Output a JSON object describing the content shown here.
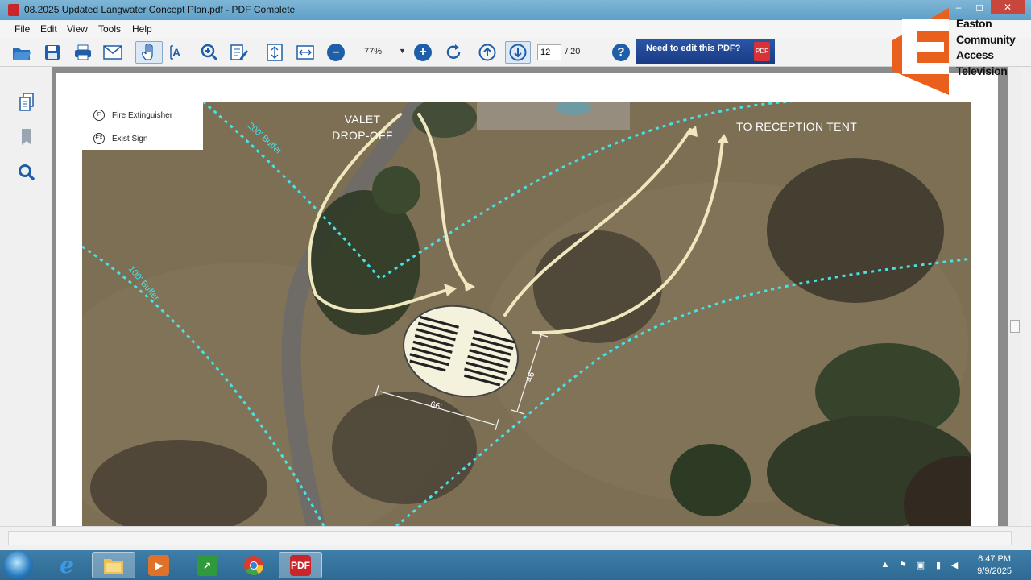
{
  "window": {
    "title": "08.2025 Updated Langwater Concept Plan.pdf - PDF Complete",
    "controls": [
      "–",
      "◻",
      "✕"
    ]
  },
  "menu": {
    "items": [
      "File",
      "Edit",
      "View",
      "Tools",
      "Help"
    ]
  },
  "toolbar": {
    "icons": [
      "open-folder-icon",
      "save-icon",
      "print-icon",
      "email-icon",
      "hand-tool-icon",
      "text-select-icon",
      "zoom-tool-icon",
      "edit-icon",
      "fit-page-icon",
      "fit-width-icon",
      "zoom-out-icon",
      "zoom-in-icon",
      "rotate-icon",
      "previous-page-icon",
      "next-page-icon",
      "help-icon"
    ],
    "zoom_value": "77%",
    "page_current": "12",
    "page_total": "/ 20",
    "promo_label": "Need to edit this PDF?",
    "promo_icon_text": "PDF"
  },
  "side_panel": {
    "icons": [
      "pages-icon",
      "bookmark-icon",
      "search-icon"
    ]
  },
  "map": {
    "legend": [
      {
        "symbol": "F",
        "label": "Fire Extinguisher"
      },
      {
        "symbol": "EX",
        "label": "Exist Sign"
      }
    ],
    "labels": {
      "valet_line1": "VALET",
      "valet_line2": "DROP-OFF",
      "reception": "TO RECEPTION TENT",
      "buffer_200": "200' Buffer",
      "buffer_100": "100' Buffer",
      "dim_66": "66'",
      "dim_46": "46'"
    },
    "colors": {
      "buffer": "#45e2e8",
      "path": "#efe7bd",
      "ground": "#7b6d52"
    }
  },
  "logo": {
    "line1": "Easton",
    "line2": "Community",
    "line3": "Access",
    "line4": "Television",
    "color": "#e8601c"
  },
  "taskbar": {
    "apps": [
      "internet-explorer-icon",
      "file-explorer-icon",
      "media-player-icon",
      "stock-chart-icon",
      "chrome-icon",
      "pdf-complete-icon"
    ],
    "pdf_icon_text": "PDF",
    "time": "6:47 PM",
    "date": "9/9/2025"
  }
}
